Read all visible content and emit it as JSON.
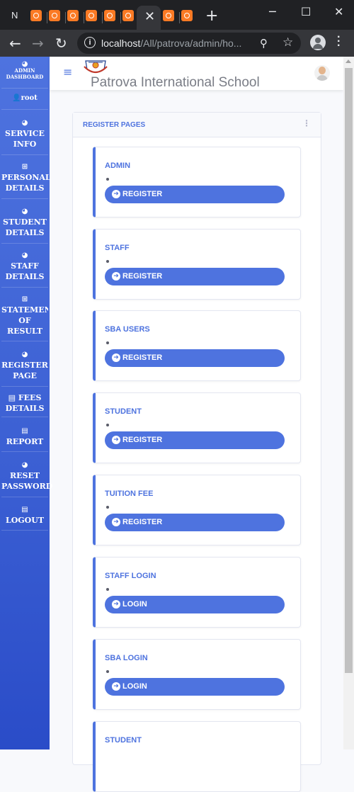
{
  "browser": {
    "first_tab_label": "N",
    "close_glyph": "✕",
    "new_tab_glyph": "+",
    "url_host": "localhost",
    "url_path": "/All/patrova/admin/ho..."
  },
  "sidebar": {
    "items": [
      {
        "label": "ADMIN DASHBOARD",
        "icon": "gauge-icon"
      },
      {
        "label": "root",
        "icon": "user-icon"
      },
      {
        "label": "SERVICE INFO",
        "icon": "gauge-icon"
      },
      {
        "label": "PERSONAL DETAILS",
        "icon": "table-icon"
      },
      {
        "label": "STUDENT DETAILS",
        "icon": "gauge-icon"
      },
      {
        "label": "STAFF DETAILS",
        "icon": "gauge-icon"
      },
      {
        "label": "STATEMENT OF RESULT",
        "icon": "table-icon"
      },
      {
        "label": "REGISTER PAGE",
        "icon": "gauge-icon"
      },
      {
        "label": "FEES DETAILS",
        "icon": "clipboard-icon"
      },
      {
        "label": "REPORT",
        "icon": "clipboard-icon"
      },
      {
        "label": "RESET PASSWORD",
        "icon": "gauge-icon"
      },
      {
        "label": "LOGOUT",
        "icon": "clipboard-icon"
      }
    ]
  },
  "topbar": {
    "school_name": "Patrova International School"
  },
  "main": {
    "card_title": "REGISTER PAGES",
    "entries": [
      {
        "title": "ADMIN",
        "button": "REGISTER"
      },
      {
        "title": "STAFF",
        "button": "REGISTER"
      },
      {
        "title": "SBA USERS",
        "button": "REGISTER"
      },
      {
        "title": "STUDENT",
        "button": "REGISTER"
      },
      {
        "title": "TUITION FEE",
        "button": "REGISTER"
      },
      {
        "title": "STAFF LOGIN",
        "button": "LOGIN"
      },
      {
        "title": "SBA LOGIN",
        "button": "LOGIN"
      },
      {
        "title": "STUDENT",
        "button": ""
      }
    ]
  },
  "colors": {
    "primary": "#4e73df",
    "sidebar_dark": "#2a4cc8",
    "chrome_dark": "#202124",
    "xampp_orange": "#fb7a24"
  }
}
